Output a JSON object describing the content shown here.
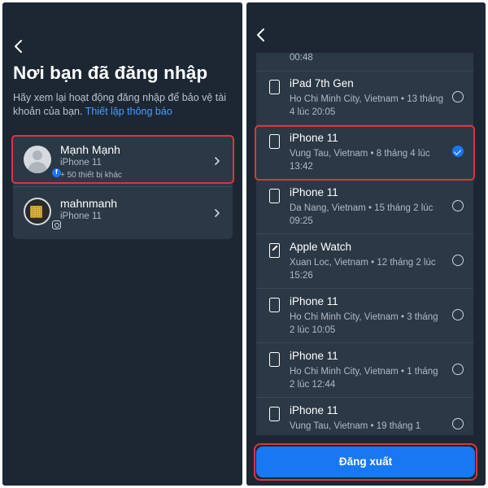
{
  "colors": {
    "panel_bg": "#1c2733",
    "card_bg": "#2b3845",
    "accent": "#1877f2",
    "link": "#4c9cff",
    "highlight": "#d9363e",
    "muted_text": "#aebbc7"
  },
  "left": {
    "back_icon": "chevron-left-icon",
    "title": "Nơi bạn đã đăng nhập",
    "subtitle": "Hãy xem lại hoạt động đăng nhập để bảo vệ tài khoản của bạn.",
    "subtitle_link": "Thiết lập thông báo",
    "accounts": [
      {
        "name": "Mạnh Mạnh",
        "device": "iPhone 11",
        "more": "+ 50 thiết bị khác",
        "platform_icon": "facebook-icon"
      },
      {
        "name": "mahnmanh",
        "device": "iPhone 11",
        "platform_icon": "instagram-icon"
      }
    ]
  },
  "right": {
    "back_icon": "chevron-left-icon",
    "partial_row_text": "00:48",
    "devices": [
      {
        "name": "iPad 7th Gen",
        "location": "Ho Chi Minh City, Vietnam • 13 tháng 4 lúc 20:05",
        "icon": "ipad-icon",
        "selected": false
      },
      {
        "name": "iPhone 11",
        "location": "Vung Tau, Vietnam • 8 tháng 4 lúc 13:42",
        "icon": "iphone-icon",
        "selected": true
      },
      {
        "name": "iPhone 11",
        "location": "Da Nang, Vietnam • 15 tháng 2 lúc 09:25",
        "icon": "iphone-icon",
        "selected": false
      },
      {
        "name": "Apple Watch",
        "location": "Xuan Loc, Vietnam • 12 tháng 2 lúc 15:26",
        "icon": "apple-watch-icon",
        "selected": false
      },
      {
        "name": "iPhone 11",
        "location": "Ho Chi Minh City, Vietnam • 3 tháng 2 lúc 10:05",
        "icon": "iphone-icon",
        "selected": false
      },
      {
        "name": "iPhone 11",
        "location": "Ho Chi Minh City, Vietnam • 1 tháng 2 lúc 12:44",
        "icon": "iphone-icon",
        "selected": false
      },
      {
        "name": "iPhone 11",
        "location": "Vung Tau, Vietnam • 19 tháng 1",
        "icon": "iphone-icon",
        "selected": false
      }
    ],
    "logout_label": "Đăng xuất"
  }
}
